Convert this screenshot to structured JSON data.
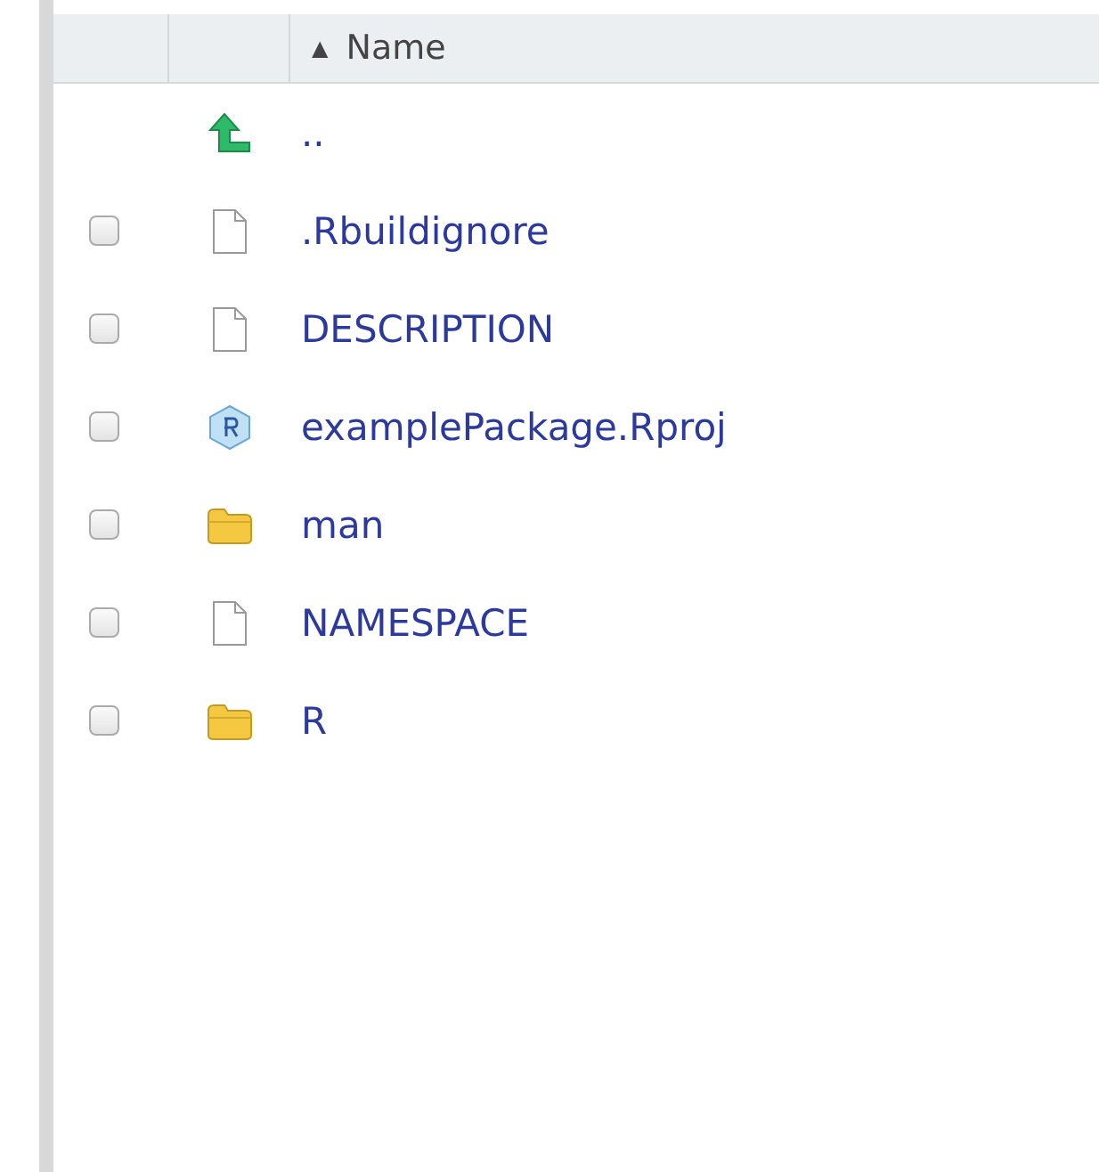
{
  "table": {
    "columns": [
      {
        "label": "Name",
        "sort_indicator": "▲"
      }
    ],
    "rows": [
      {
        "kind": "parent",
        "name": ".."
      },
      {
        "kind": "file",
        "name": ".Rbuildignore",
        "checked": false
      },
      {
        "kind": "file",
        "name": "DESCRIPTION",
        "checked": false
      },
      {
        "kind": "project",
        "name": "examplePackage.Rproj",
        "checked": false
      },
      {
        "kind": "folder",
        "name": "man",
        "checked": false
      },
      {
        "kind": "file",
        "name": "NAMESPACE",
        "checked": false
      },
      {
        "kind": "folder",
        "name": "R",
        "checked": false
      }
    ]
  }
}
